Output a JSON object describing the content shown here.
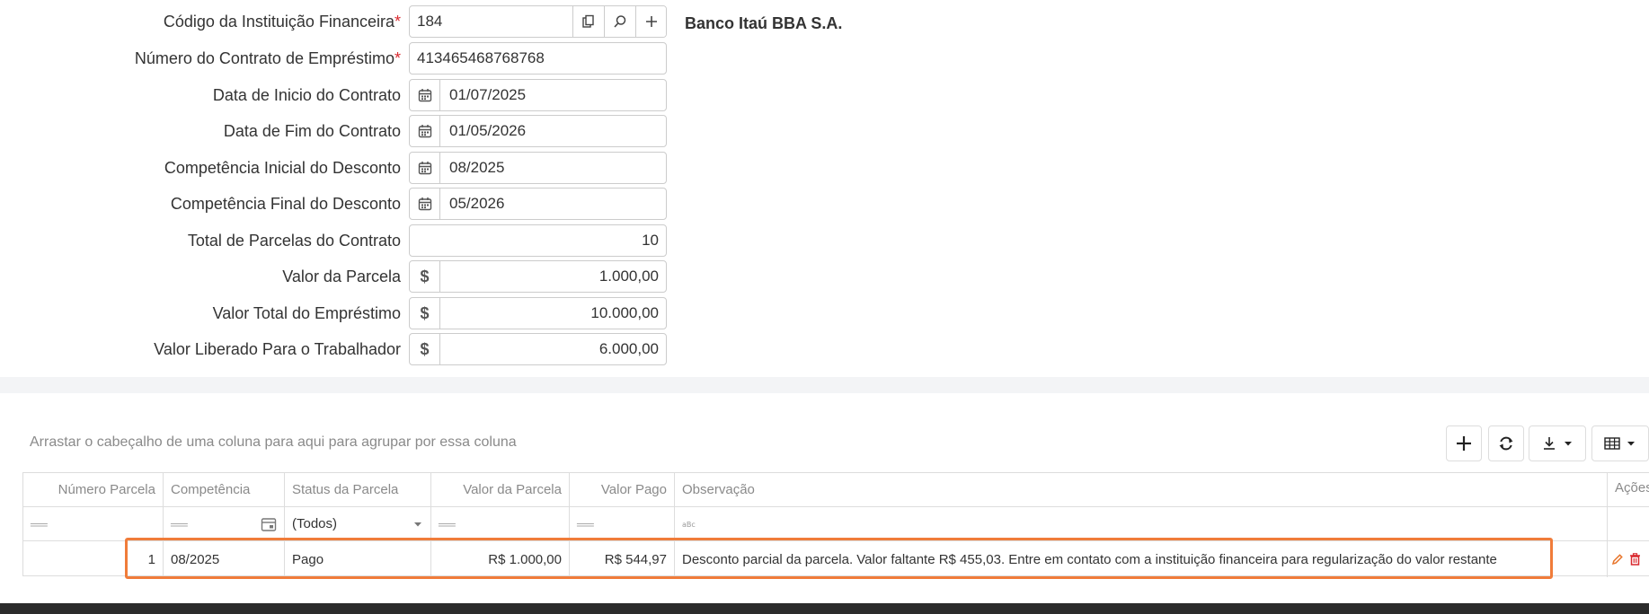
{
  "form": {
    "institution_code": {
      "label": "Código da Instituição Financeira",
      "value": "184",
      "bank_name": "Banco Itaú BBA S.A."
    },
    "contract_number": {
      "label": "Número do Contrato de Empréstimo",
      "value": "413465468768768"
    },
    "start_date": {
      "label": "Data de Inicio do Contrato",
      "value": "01/07/2025"
    },
    "end_date": {
      "label": "Data de Fim do Contrato",
      "value": "01/05/2026"
    },
    "initial_competence": {
      "label": "Competência Inicial do Desconto",
      "value": "08/2025"
    },
    "final_competence": {
      "label": "Competência Final do Desconto",
      "value": "05/2026"
    },
    "total_installments": {
      "label": "Total de Parcelas do Contrato",
      "value": "10"
    },
    "installment_value": {
      "label": "Valor da Parcela",
      "value": "1.000,00"
    },
    "loan_total": {
      "label": "Valor Total do Empréstimo",
      "value": "10.000,00"
    },
    "released_value": {
      "label": "Valor Liberado Para o Trabalhador",
      "value": "6.000,00"
    },
    "required_mark": "*",
    "currency_symbol": "$"
  },
  "grid": {
    "group_panel_text": "Arrastar o cabeçalho de uma coluna para aqui para agrupar por essa coluna",
    "columns": [
      "Número Parcela",
      "Competência",
      "Status da Parcela",
      "Valor da Parcela",
      "Valor Pago",
      "Observação",
      "Ações"
    ],
    "status_filter": "(Todos)",
    "rows": [
      {
        "numero": "1",
        "competencia": "08/2025",
        "status": "Pago",
        "valor_parcela": "R$ 1.000,00",
        "valor_pago": "R$ 544,97",
        "observacao": "Desconto parcial da parcela. Valor faltante R$ 455,03. Entre em contato com a instituição financeira para regularização do valor restante"
      }
    ]
  },
  "colors": {
    "accent": "#f07c3a",
    "required": "#d9292f",
    "delete": "#d9292f",
    "edit": "#e8752b"
  }
}
